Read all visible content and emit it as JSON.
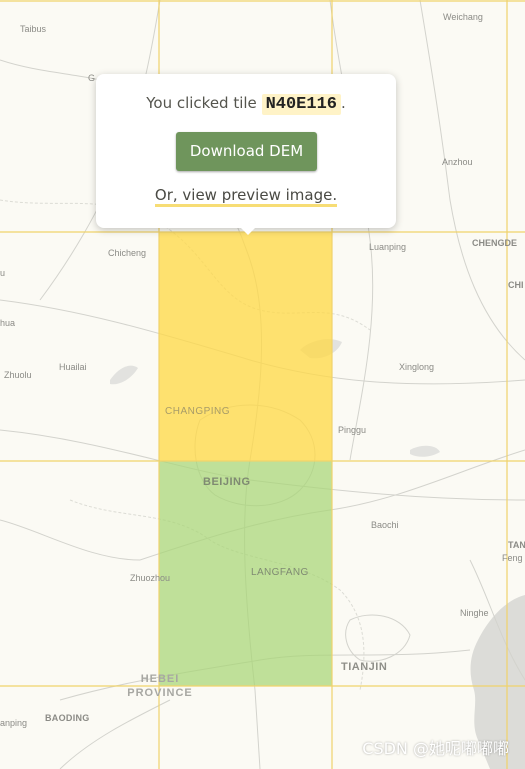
{
  "map": {
    "tile_grid_color": "#f0d36b",
    "selected_tile_color": "#ffd843",
    "neighbor_tile_color": "#a8d676",
    "road_color": "#cfcfc9",
    "water_color": "#dedfdc",
    "labels": {
      "taibus": "Taibus",
      "weichang": "Weichang",
      "anzhou": "Anzhou",
      "chicheng": "Chicheng",
      "luanping": "Luanping",
      "chengde": "CHENGDE",
      "chi": "CHI",
      "u": "u",
      "hua": "hua",
      "huailai": "Huailai",
      "zhuolu": "Zhuolu",
      "xinglong": "Xinglong",
      "changping": "CHANGPING",
      "pinggu": "Pinggu",
      "beijing": "BEIJING",
      "baochi": "Baochi",
      "tan": "TAN",
      "feng": "Feng",
      "zhuozhou": "Zhuozhou",
      "langfang": "LANGFANG",
      "ninghe": "Ninghe",
      "hebei": "HEBEI",
      "province": "PROVINCE",
      "tianjin": "TIANJIN",
      "baoding": "BAODING",
      "anping": "anping",
      "g_fragment": "G"
    }
  },
  "popup": {
    "prefix": "You clicked tile",
    "tile": "N40E116",
    "suffix": ".",
    "download_label": "Download DEM",
    "preview_label": "Or, view preview image."
  },
  "watermark": "CSDN @她呢嘟嘟嘟"
}
